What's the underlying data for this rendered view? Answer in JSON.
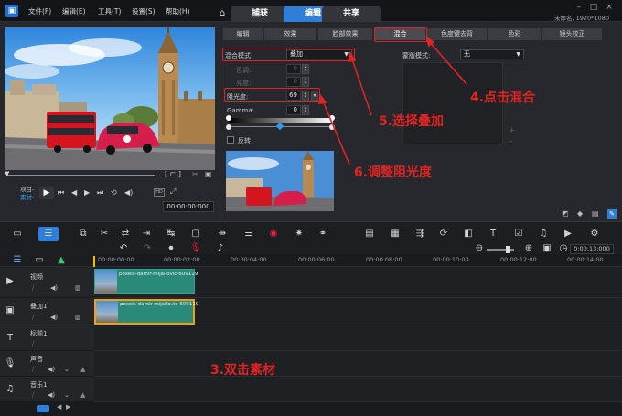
{
  "menubar": {
    "items": [
      "文件(F)",
      "编辑(E)",
      "工具(T)",
      "设置(S)",
      "帮助(H)"
    ],
    "tabs": [
      "捕获",
      "编辑",
      "共享"
    ],
    "active_tab": "编辑",
    "project_info": "未命名, 1920*1080"
  },
  "preview": {
    "mode_project": "项目-",
    "mode_clip": "素材-",
    "timecode": "00:00:00:000"
  },
  "options": {
    "tabs": [
      "编辑",
      "效果",
      "脸部效果",
      "混合",
      "色度键去背",
      "色彩",
      "镜头校正"
    ],
    "active_tab": "混合",
    "blend_mode_label": "混合模式:",
    "blend_mode_value": "叠加",
    "mask_mode_label": "蒙版模式:",
    "mask_mode_value": "无",
    "hue_label": "色调:",
    "hue_value": "0",
    "lightness_label": "亮度:",
    "lightness_value": "0",
    "opacity_label": "阻光度:",
    "opacity_value": "69",
    "gamma_label": "Gamma:",
    "gamma_value": "0",
    "invert_label": "反转"
  },
  "annotations": {
    "step4": "4.点击混合",
    "step5": "5.选择叠加",
    "step6": "6.调整阻光度",
    "step3": "3.双击素材"
  },
  "timeline": {
    "zoom_timecode": "0:00:13:000",
    "ruler_ticks": [
      "00:00:00:00",
      "00:00:02:00",
      "00:00:04:00",
      "00:00:06:00",
      "00:00:08:00",
      "00:00:10:00",
      "00:00:12:00",
      "00:00:14:00"
    ],
    "tracks": {
      "video": "视频",
      "overlay": "叠加1",
      "title": "标题1",
      "voice": "声音",
      "music": "音乐1"
    },
    "clip_name": "pexels-damir-mijailovic-609119"
  },
  "colors": {
    "accent": "#2f7ed8",
    "annotation_red": "#e02424",
    "clip_teal": "#2a8a7a"
  }
}
